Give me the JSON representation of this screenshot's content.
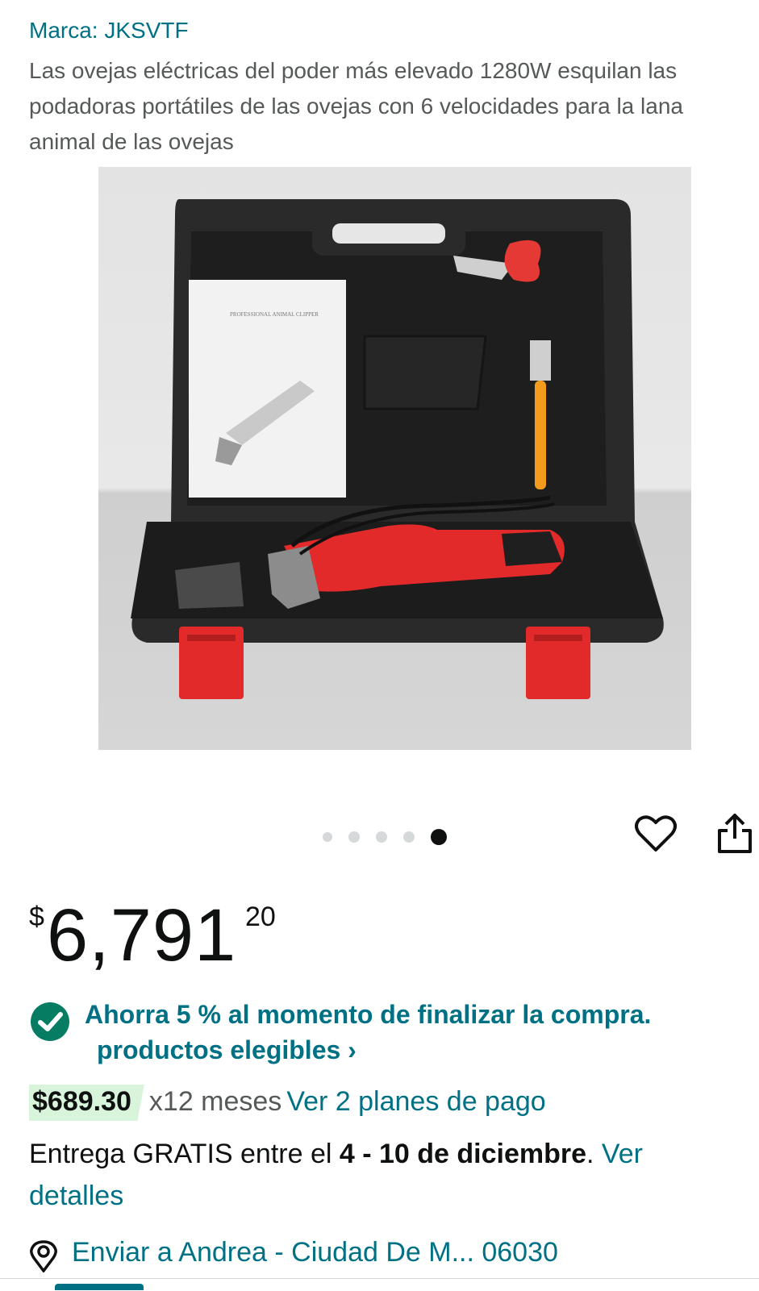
{
  "brand": "Marca: JKSVTF",
  "title": "Las ovejas eléctricas del poder más elevado 1280W esquilan las podadoras portátiles de las ovejas con 6 velocidades para la lana animal de las ovejas",
  "image": {
    "manual_text": "PROFESSIONAL ANIMAL CLIPPER",
    "alt_icon": "product-photo"
  },
  "carousel": {
    "count": 5,
    "active_index": 4
  },
  "actions": {
    "wishlist_icon": "heart-icon",
    "share_icon": "share-icon"
  },
  "price": {
    "currency": "$",
    "whole": "6,791",
    "fraction": "20"
  },
  "promo": {
    "line1": "Ahorra 5 % al momento de finalizar la compra.",
    "line2": "productos elegibles ›"
  },
  "installments": {
    "amount": "$689.30",
    "months": "x12 meses",
    "link": "Ver 2 planes de pago"
  },
  "delivery": {
    "prefix": "Entrega GRATIS entre el ",
    "dates": "4 - 10 de diciembre",
    "suffix": ". ",
    "link": "Ver detalles"
  },
  "ship_to": "Enviar a Andrea - Ciudad De M... 06030",
  "colors": {
    "link": "#007185",
    "success": "#067d62",
    "highlight": "#d8f5dc",
    "text": "#0f1111"
  }
}
